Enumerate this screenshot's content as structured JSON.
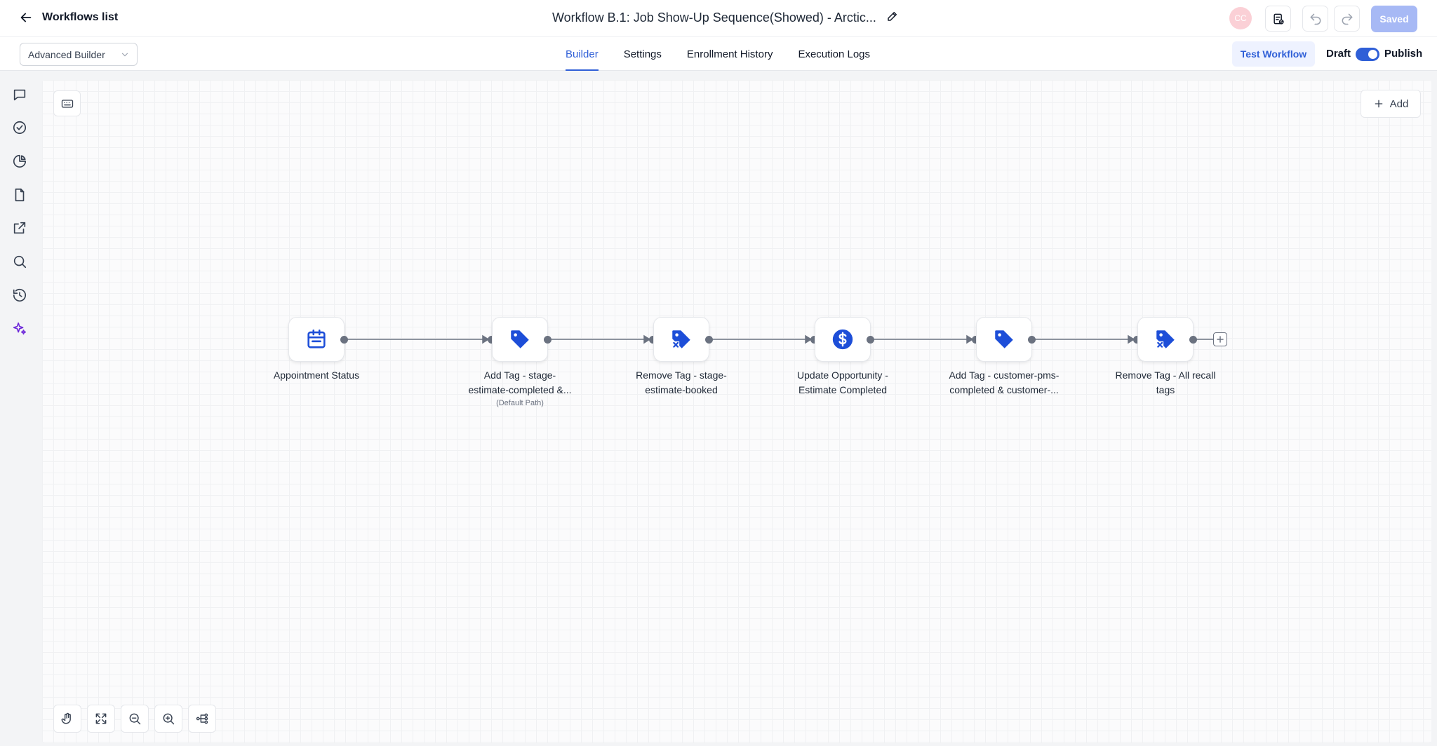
{
  "header": {
    "back_label": "Workflows list",
    "workflow_title": "Workflow B.1: Job Show-Up Sequence(Showed) - Arctic...",
    "avatar_initials": "CC",
    "saved_label": "Saved"
  },
  "subheader": {
    "builder_select": "Advanced Builder",
    "tabs": [
      {
        "label": "Builder",
        "active": true
      },
      {
        "label": "Settings",
        "active": false
      },
      {
        "label": "Enrollment History",
        "active": false
      },
      {
        "label": "Execution Logs",
        "active": false
      }
    ],
    "test_workflow_label": "Test Workflow",
    "draft_label": "Draft",
    "publish_label": "Publish",
    "publish_toggle_on": true
  },
  "rail": {
    "icons": [
      "chat-icon",
      "check-circle-icon",
      "pie-chart-icon",
      "document-icon",
      "external-link-icon",
      "search-icon",
      "history-icon",
      "sparkles-icon"
    ]
  },
  "canvas": {
    "add_label": "Add",
    "nodes": [
      {
        "icon": "calendar-icon",
        "label_line1": "Appointment Status",
        "label_line2": "",
        "sub": ""
      },
      {
        "icon": "tag-icon",
        "label_line1": "Add Tag - stage-",
        "label_line2": "estimate-completed &...",
        "sub": "(Default Path)"
      },
      {
        "icon": "tag-remove-icon",
        "label_line1": "Remove Tag - stage-",
        "label_line2": "estimate-booked",
        "sub": ""
      },
      {
        "icon": "dollar-icon",
        "label_line1": "Update Opportunity -",
        "label_line2": "Estimate Completed",
        "sub": ""
      },
      {
        "icon": "tag-icon",
        "label_line1": "Add Tag - customer-pms-",
        "label_line2": "completed & customer-...",
        "sub": ""
      },
      {
        "icon": "tag-remove-icon",
        "label_line1": "Remove Tag - All recall",
        "label_line2": "tags",
        "sub": ""
      }
    ],
    "bottom_tools": [
      "hand-icon",
      "expand-icon",
      "zoom-out-icon",
      "zoom-in-icon",
      "layout-icon"
    ]
  },
  "colors": {
    "accent": "#2f5fd7",
    "node_icon": "#1d4ed8",
    "connector": "#6b7280"
  }
}
